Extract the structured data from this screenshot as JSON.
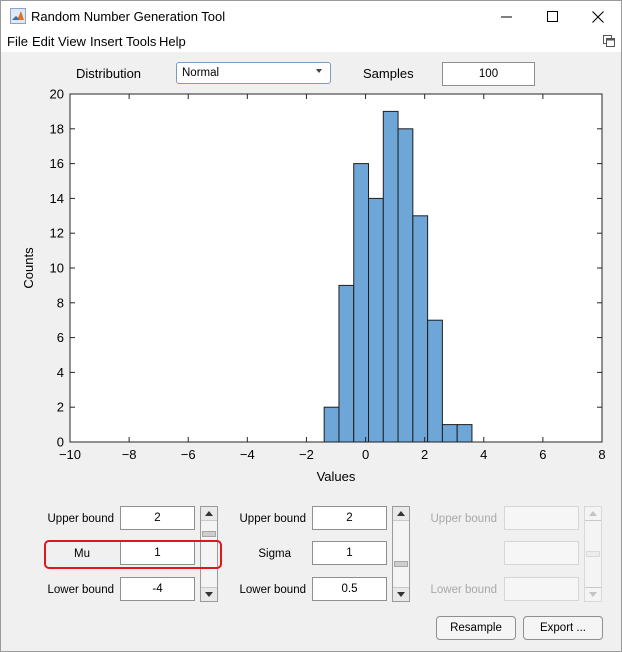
{
  "window": {
    "title": "Random Number Generation Tool"
  },
  "menu": [
    "File",
    "Edit",
    "View",
    "Insert",
    "Tools",
    "Help"
  ],
  "distribution": {
    "label": "Distribution",
    "selected": "Normal"
  },
  "samples": {
    "label": "Samples",
    "value": "100"
  },
  "chart_data": {
    "type": "bar",
    "xlabel": "Values",
    "ylabel": "Counts",
    "xlim": [
      -10,
      8
    ],
    "ylim": [
      0,
      20
    ],
    "xticks": [
      -10,
      -8,
      -6,
      -4,
      -2,
      0,
      2,
      4,
      6,
      8
    ],
    "yticks": [
      0,
      2,
      4,
      6,
      8,
      10,
      12,
      14,
      16,
      18,
      20
    ],
    "bin_width": 0.5,
    "bin_edges": [
      -1.4,
      -0.9,
      -0.4,
      0.1,
      0.6,
      1.1,
      1.6,
      2.1,
      2.6,
      3.1,
      3.6
    ],
    "values": [
      2,
      9,
      16,
      14,
      19,
      18,
      13,
      7,
      1,
      1
    ],
    "bar_color": "#6ea6d8",
    "grid": false
  },
  "param1": {
    "upper_label": "Upper bound",
    "upper_value": "2",
    "name": "Mu",
    "value": "1",
    "lower_label": "Lower bound",
    "lower_value": "-4",
    "slider_fraction": 0.83
  },
  "param2": {
    "upper_label": "Upper bound",
    "name": "Sigma",
    "upper_value": "2",
    "value": "1",
    "lower_label": "Lower bound",
    "lower_value": "0.5",
    "slider_fraction": 0.33
  },
  "param3": {
    "upper_label": "Upper bound",
    "upper_value": "",
    "name": "",
    "value": "",
    "lower_label": "Lower bound",
    "lower_value": "",
    "slider_fraction": 0.5
  },
  "buttons": {
    "resample": "Resample",
    "export": "Export ..."
  },
  "colors": {
    "highlight": "#e0161b",
    "accent": "#0078d7"
  }
}
